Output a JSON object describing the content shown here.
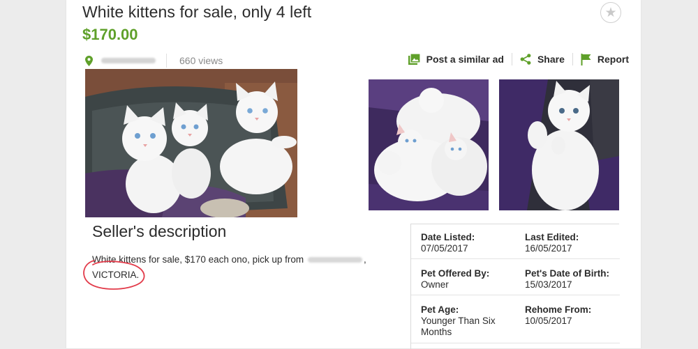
{
  "listing": {
    "title": "White kittens for sale, only 4 left",
    "price": "$170.00",
    "views": "660 views"
  },
  "actions": {
    "post_similar": "Post a similar ad",
    "share": "Share",
    "report": "Report"
  },
  "icons": {
    "favourite": "star-icon",
    "location": "location-pin-icon",
    "post_similar": "image-gallery-icon",
    "share": "share-icon",
    "report": "flag-icon"
  },
  "colors": {
    "price_green": "#5fa02a",
    "icon_green": "#5fa02a",
    "annotation_red": "#e23b4a"
  },
  "seller": {
    "heading": "Seller's description",
    "description_start": "White kittens for sale, $170 each ono, pick up from",
    "description_end": ",",
    "description_line2": "VICTORIA."
  },
  "details": [
    {
      "label": "Date Listed:",
      "value": "07/05/2017"
    },
    {
      "label": "Last Edited:",
      "value": "16/05/2017"
    },
    {
      "label": "Pet Offered By:",
      "value": "Owner"
    },
    {
      "label": "Pet's Date of Birth:",
      "value": "15/03/2017"
    },
    {
      "label": "Pet Age:",
      "value": "Younger Than Six Months"
    },
    {
      "label": "Rehome From:",
      "value": "10/05/2017"
    }
  ]
}
